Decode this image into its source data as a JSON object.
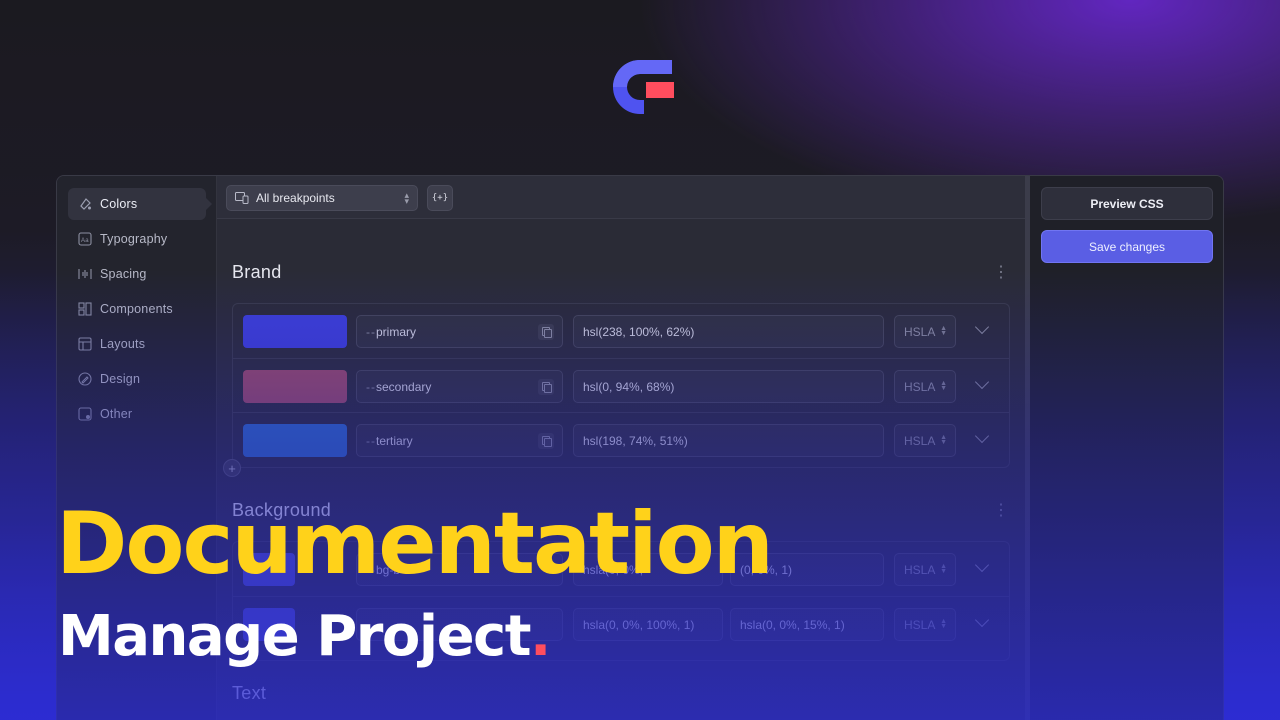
{
  "logo": {
    "name": "app-logo",
    "colors": {
      "c_shape": "#4f53f0",
      "accent": "#ff4d5e"
    }
  },
  "sidebar": {
    "items": [
      {
        "label": "Colors",
        "icon": "palette-icon",
        "active": true
      },
      {
        "label": "Typography",
        "icon": "typography-icon",
        "active": false
      },
      {
        "label": "Spacing",
        "icon": "spacing-icon",
        "active": false
      },
      {
        "label": "Components",
        "icon": "components-icon",
        "active": false
      },
      {
        "label": "Layouts",
        "icon": "layouts-icon",
        "active": false
      },
      {
        "label": "Design",
        "icon": "design-icon",
        "active": false
      },
      {
        "label": "Other",
        "icon": "other-icon",
        "active": false
      }
    ]
  },
  "toolbar": {
    "breakpoint_select": "All breakpoints",
    "code_button": "{+}"
  },
  "sections": {
    "brand": {
      "title": "Brand",
      "rows": [
        {
          "var_prefix": "--",
          "var_name": "primary",
          "value": "hsl(238, 100%, 62%)",
          "format": "HSLA",
          "swatch": "#3d3fd8"
        },
        {
          "var_prefix": "--",
          "var_name": "secondary",
          "value": "hsl(0, 94%, 68%)",
          "format": "HSLA",
          "swatch": "#9b4a66"
        },
        {
          "var_prefix": "--",
          "var_name": "tertiary",
          "value": "hsl(198, 74%, 51%)",
          "format": "HSLA",
          "swatch": "#2d6ac4"
        }
      ]
    },
    "background": {
      "title": "Background",
      "rows": [
        {
          "var_prefix": "--",
          "var_name": "bg-b",
          "value": "hsla(0, 0%,",
          "value2": "(0, 0%, 1)",
          "format": "HSLA",
          "swatch": "#4a4fc8"
        },
        {
          "var_prefix": "",
          "var_name": "",
          "value": "hsla(0, 0%, 100%, 1)",
          "value2": "hsla(0, 0%, 15%, 1)",
          "format": "HSLA",
          "swatch": "#4a4fc8"
        }
      ]
    },
    "text": {
      "title": "Text"
    }
  },
  "right_panel": {
    "preview_label": "Preview CSS",
    "save_label": "Save changes"
  },
  "hero": {
    "title": "Documentation",
    "subtitle": "Manage Project",
    "subtitle_dot": "."
  },
  "colors": {
    "accent_yellow": "#ffd21a",
    "accent_red": "#ff4d5e",
    "primary_button": "#5a5ee4"
  }
}
